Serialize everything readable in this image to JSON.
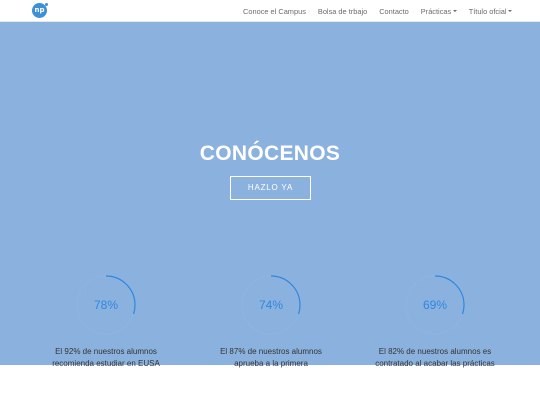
{
  "nav": {
    "logo_text": "np",
    "items": [
      {
        "label": "Conoce el Campus",
        "dropdown": false
      },
      {
        "label": "Bolsa de trbajo",
        "dropdown": false
      },
      {
        "label": "Contacto",
        "dropdown": false
      },
      {
        "label": "Prácticas",
        "dropdown": true
      },
      {
        "label": "Título ofcial",
        "dropdown": true
      }
    ]
  },
  "hero": {
    "title": "CONÓCENOS",
    "button_label": "HAZLO YA"
  },
  "stats": [
    {
      "percent_label": "78%",
      "ring_fill": 0.3,
      "text": "El 92% de nuestros alumnos recomienda estudiar en EUSA"
    },
    {
      "percent_label": "74%",
      "ring_fill": 0.3,
      "text": "El 87% de nuestros alumnos aprueba a la primera"
    },
    {
      "percent_label": "69%",
      "ring_fill": 0.3,
      "text": "El 82% de nuestros alumnos es contratado al acabar las prácticas"
    }
  ],
  "colors": {
    "hero_bg": "#8bb2df",
    "accent": "#2f86df",
    "logo": "#3d8fd8"
  }
}
